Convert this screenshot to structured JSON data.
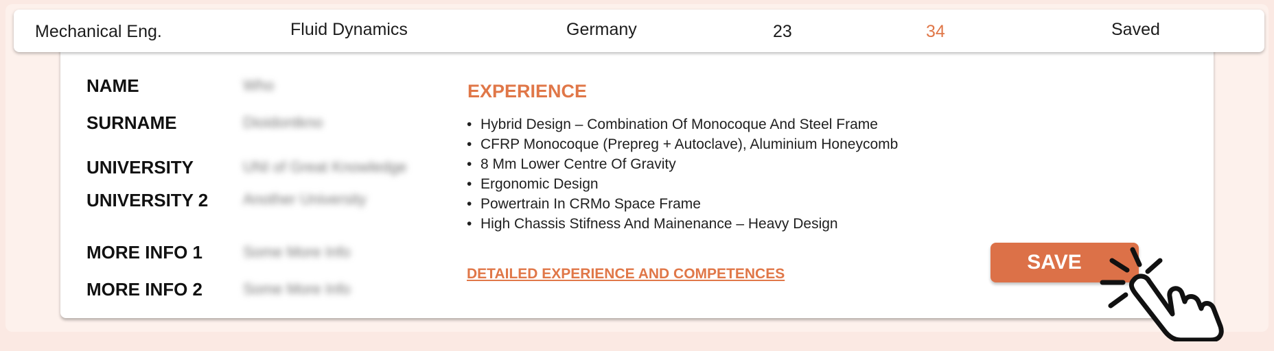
{
  "summary": {
    "field": "Mechanical Eng.",
    "topic": "Fluid Dynamics",
    "country": "Germany",
    "num1": "23",
    "num2": "34",
    "status": "Saved"
  },
  "profile": {
    "name_label": "NAME",
    "name_value": "Who",
    "surname_label": "SURNAME",
    "surname_value": "Dioidontkno",
    "university_label": "UNIVERSITY",
    "university_value": "UNI of Great Knowledge",
    "university2_label": "UNIVERSITY 2",
    "university2_value": "Another University",
    "more1_label": "MORE INFO 1",
    "more1_value": "Some More Info",
    "more2_label": "MORE INFO 2",
    "more2_value": "Some More Info"
  },
  "experience": {
    "title": "EXPERIENCE",
    "items": [
      "Hybrid Design – Combination Of Monocoque And Steel Frame",
      "CFRP Monocoque (Prepreg + Autoclave), Aluminium Honeycomb",
      "8 Mm Lower Centre Of Gravity",
      "Ergonomic Design",
      "Powertrain In CRMo Space Frame",
      "High Chassis Stifness And Mainenance – Heavy Design"
    ],
    "link": "DETAILED EXPERIENCE AND COMPETENCES"
  },
  "actions": {
    "save_label": "SAVE"
  },
  "colors": {
    "accent": "#e07748",
    "button": "#dc7148",
    "background": "#fbe9e3"
  },
  "icons": {
    "cursor": "hand-pointer-click-icon"
  }
}
